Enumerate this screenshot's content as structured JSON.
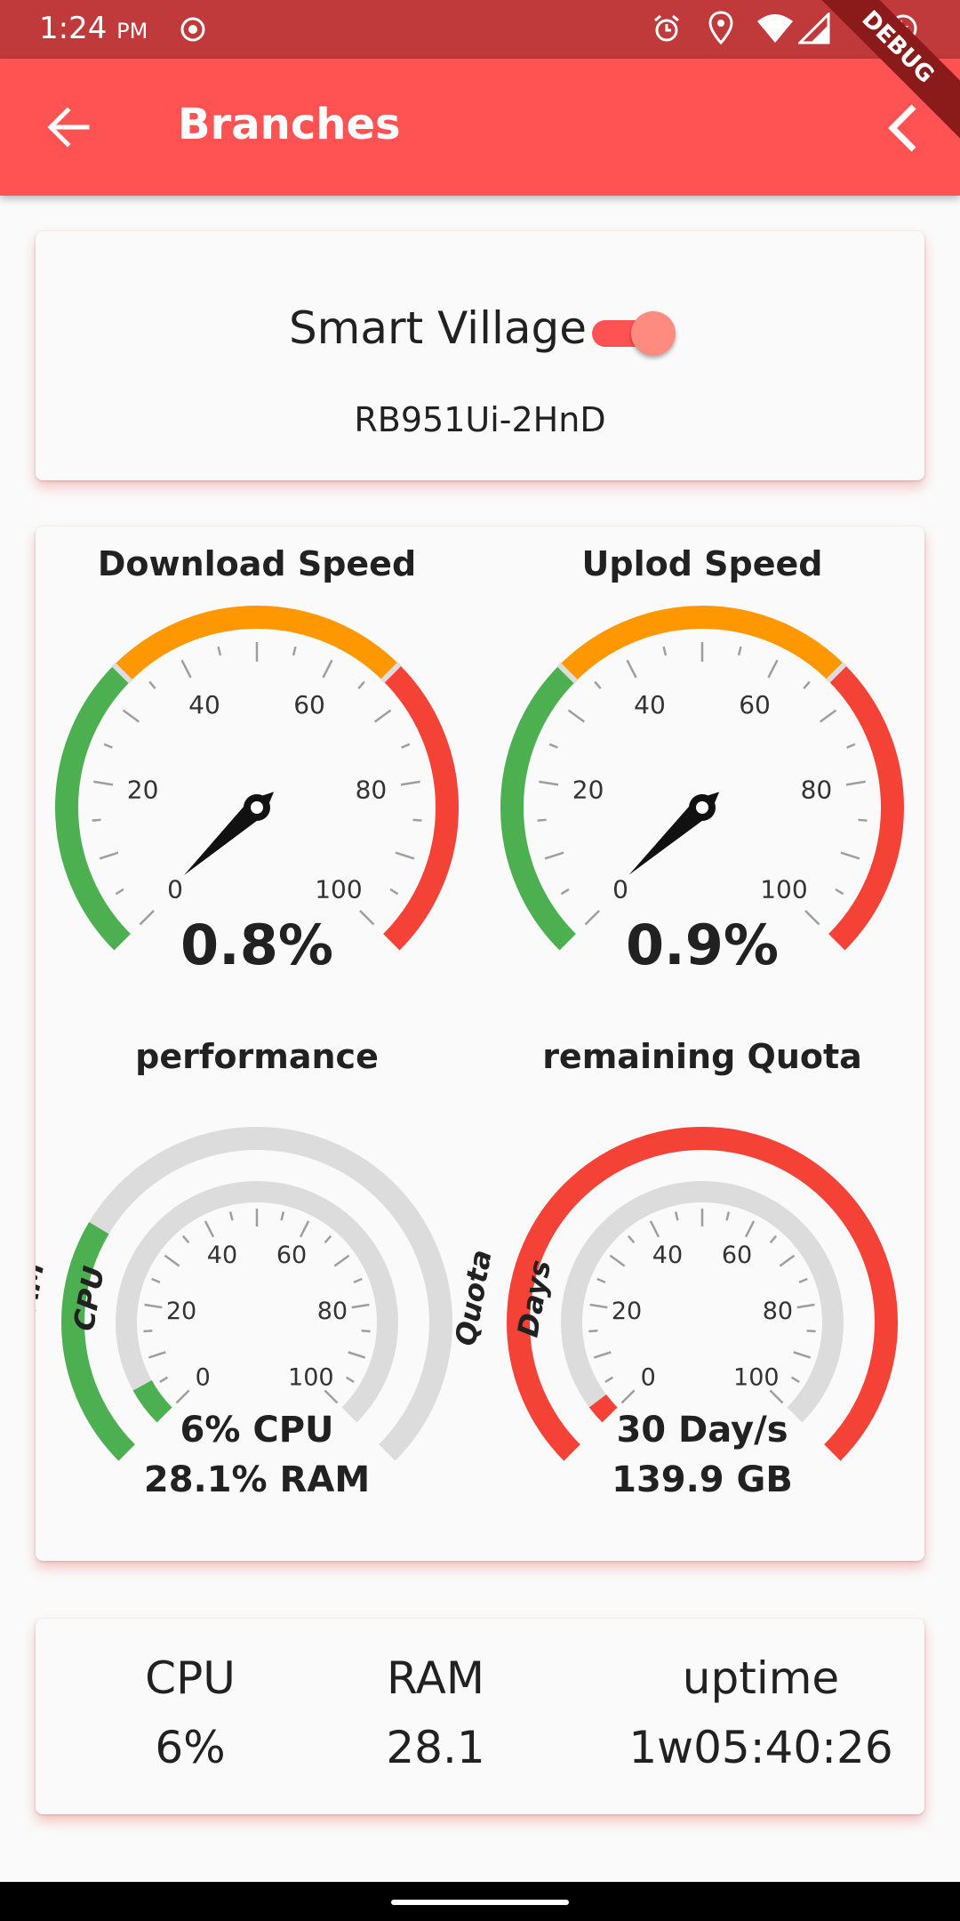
{
  "status_bar": {
    "time": "1:24",
    "ampm": "PM"
  },
  "debug_label": "DEBUG",
  "app_bar": {
    "title": "Branches"
  },
  "branch": {
    "name": "Smart Village",
    "model": "RB951Ui-2HnD",
    "enabled": true
  },
  "gauges": {
    "download": {
      "title": "Download Speed",
      "value_label": "0.8%",
      "value": 0.8,
      "ticks": [
        "0",
        "20",
        "40",
        "60",
        "80",
        "100"
      ]
    },
    "upload": {
      "title": "Uplod Speed",
      "value_label": "0.9%",
      "value": 0.9,
      "ticks": [
        "0",
        "20",
        "40",
        "60",
        "80",
        "100"
      ]
    },
    "performance": {
      "title": "performance",
      "outer_label": "RAM",
      "inner_label": "CPU",
      "line1": "6% CPU",
      "line2": "28.1% RAM",
      "outer_value": 28.1,
      "inner_value": 6,
      "ticks": [
        "0",
        "20",
        "40",
        "60",
        "80",
        "100"
      ]
    },
    "quota": {
      "title": "remaining Quota",
      "outer_label": "Quota",
      "inner_label": "Days",
      "line1": "30 Day/s",
      "line2": "139.9 GB",
      "outer_value": 100,
      "inner_value": 3,
      "ticks": [
        "0",
        "20",
        "40",
        "60",
        "80",
        "100"
      ]
    }
  },
  "stats": {
    "cpu": {
      "label": "CPU",
      "value": "6%"
    },
    "ram": {
      "label": "RAM",
      "value": "28.1"
    },
    "uptime": {
      "label": "uptime",
      "value": "1w05:40:26"
    }
  },
  "colors": {
    "green": "#4caf50",
    "orange": "#ff9800",
    "red": "#f44336",
    "track": "#dcdcdc",
    "accent": "#ff5252"
  }
}
